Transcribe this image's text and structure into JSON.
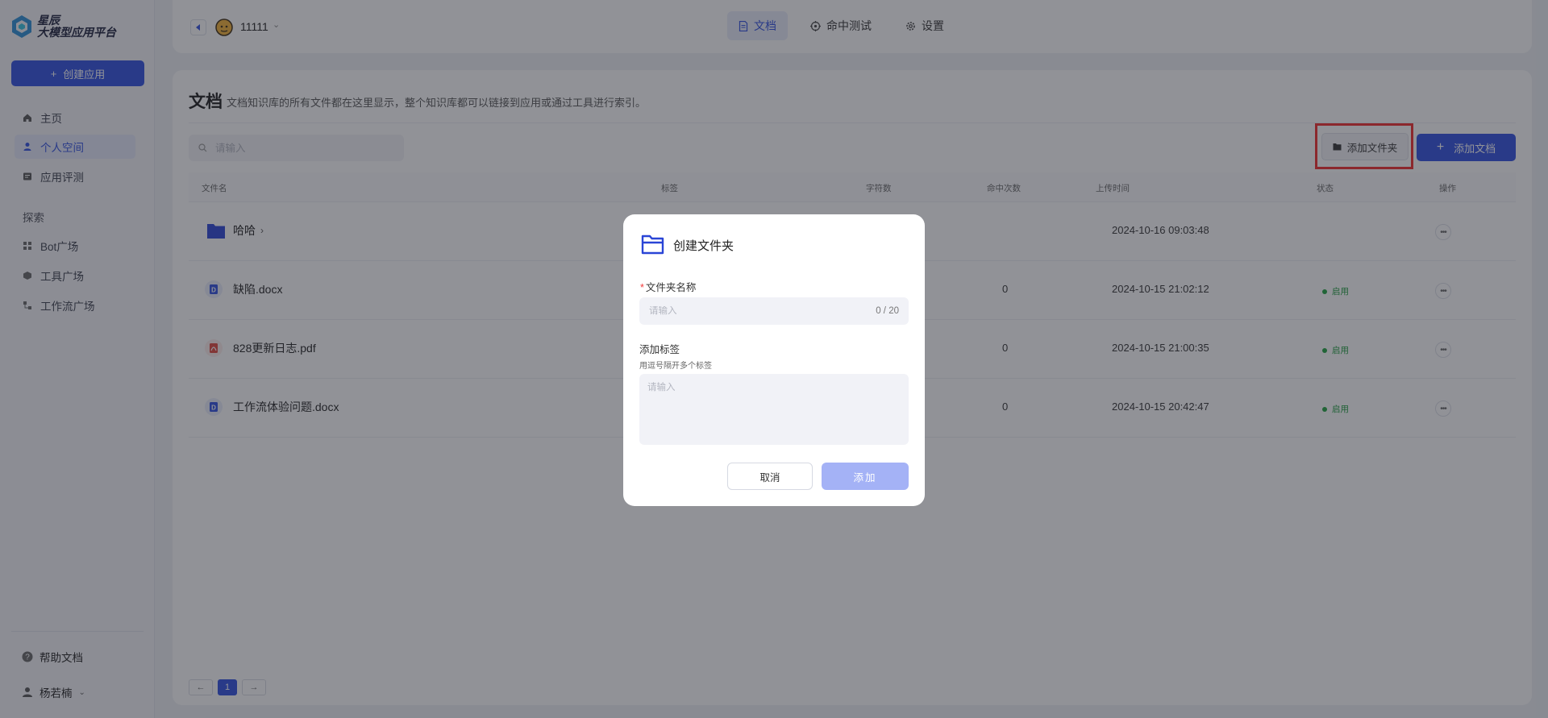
{
  "sidebar": {
    "brand_line1": "星辰",
    "brand_line2": "大模型应用平台",
    "create_label": "创建应用",
    "nav": [
      {
        "label": "主页",
        "icon": "home-icon"
      },
      {
        "label": "个人空间",
        "icon": "user-icon",
        "active": true
      },
      {
        "label": "应用评测",
        "icon": "evaluation-icon"
      }
    ],
    "explore_label": "探索",
    "explore": [
      {
        "label": "Bot广场",
        "icon": "grid-icon"
      },
      {
        "label": "工具广场",
        "icon": "cube-icon"
      },
      {
        "label": "工作流广场",
        "icon": "workflow-icon"
      }
    ],
    "help_label": "帮助文档",
    "user_name": "杨若楠"
  },
  "header": {
    "kb_name": "11111",
    "tabs": [
      {
        "label": "文档",
        "icon": "document-icon",
        "active": true
      },
      {
        "label": "命中测试",
        "icon": "target-icon"
      },
      {
        "label": "设置",
        "icon": "gear-icon"
      }
    ]
  },
  "main": {
    "title": "文档",
    "description": "文档知识库的所有文件都在这里显示，整个知识库都可以链接到应用或通过工具进行索引。",
    "search_placeholder": "请输入",
    "add_folder_label": "添加文件夹",
    "add_doc_label": "添加文档",
    "columns": [
      "文件名",
      "标签",
      "字符数",
      "命中次数",
      "上传时间",
      "状态",
      "操作"
    ],
    "rows": [
      {
        "name": "哈哈",
        "type": "folder",
        "hits": "",
        "time": "2024-10-16 09:03:48",
        "status": ""
      },
      {
        "name": "缺陷.docx",
        "type": "docx",
        "hits": "0",
        "time": "2024-10-15 21:02:12",
        "status": "启用"
      },
      {
        "name": "828更新日志.pdf",
        "type": "pdf",
        "hits": "0",
        "time": "2024-10-15 21:00:35",
        "status": "启用"
      },
      {
        "name": "工作流体验问题.docx",
        "type": "docx",
        "hits": "0",
        "time": "2024-10-15 20:42:47",
        "status": "启用"
      }
    ],
    "pagination": {
      "prev": "←",
      "current": "1",
      "next": "→"
    }
  },
  "modal": {
    "title": "创建文件夹",
    "name_label": "文件夹名称",
    "required_mark": "*",
    "name_placeholder": "请输入",
    "name_count": "0 / 20",
    "tag_label": "添加标签",
    "tag_hint": "用逗号隔开多个标签",
    "tag_placeholder": "请输入",
    "cancel_label": "取消",
    "add_label": "添加"
  },
  "colors": {
    "primary": "#2e4fe0",
    "highlight": "#f22a2a",
    "status_green": "#1a9c3a"
  }
}
